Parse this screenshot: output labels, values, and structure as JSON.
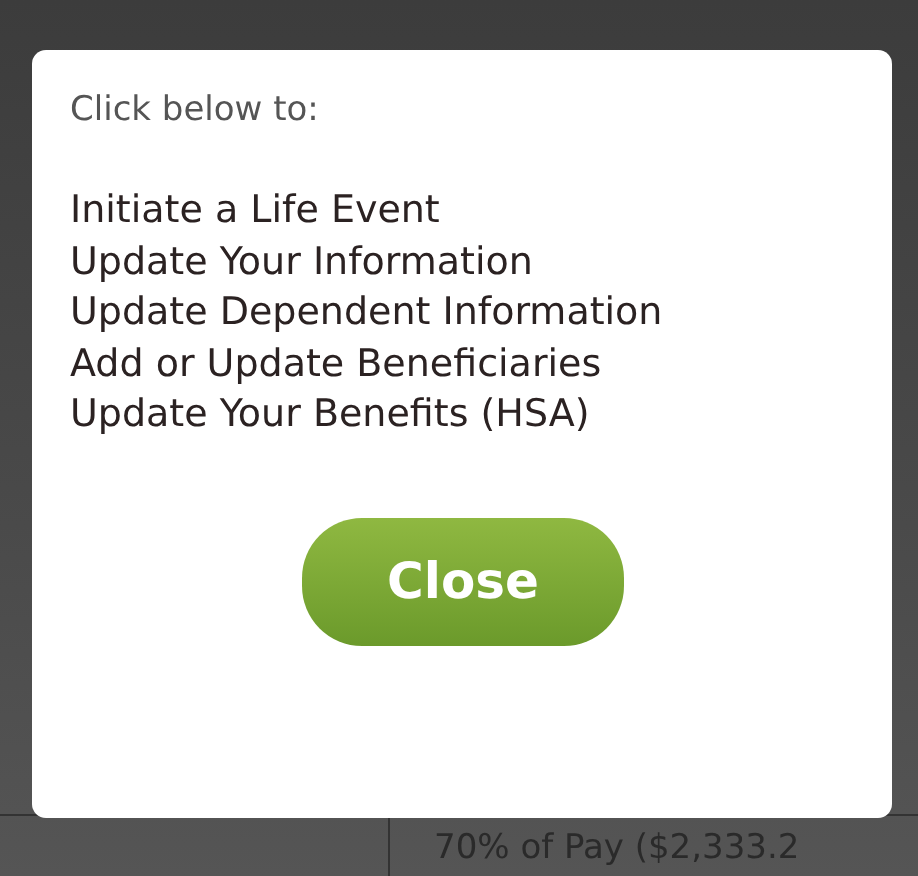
{
  "background": {
    "cell_text": "70% of Pay ($2,333.2"
  },
  "dialog": {
    "heading": "Click below to:",
    "links": [
      "Initiate a Life Event",
      "Update Your Information",
      "Update Dependent Information",
      "Add or Update Beneficiaries",
      "Update Your Benefits (HSA)"
    ],
    "button": "Close"
  }
}
